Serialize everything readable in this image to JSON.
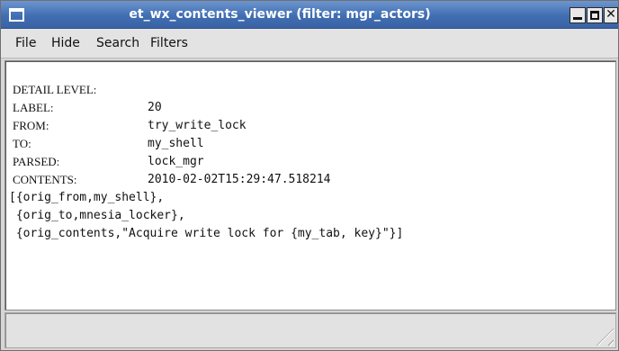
{
  "window": {
    "title": "et_wx_contents_viewer (filter: mgr_actors)"
  },
  "menu": {
    "items": [
      "File",
      "Hide",
      "Search",
      "Filters"
    ]
  },
  "detail": {
    "fields": [
      {
        "key": "DETAIL LEVEL:",
        "value": "20"
      },
      {
        "key": "LABEL:",
        "value": "try_write_lock"
      },
      {
        "key": "FROM:",
        "value": "my_shell"
      },
      {
        "key": "TO:",
        "value": "lock_mgr"
      },
      {
        "key": "PARSED:",
        "value": "2010-02-02T15:29:47.518214"
      },
      {
        "key": "CONTENTS:",
        "value": ""
      }
    ],
    "contents_lines": [
      "[{orig_from,my_shell},",
      " {orig_to,mnesia_locker},",
      " {orig_contents,\"Acquire write lock for {my_tab, key}\"}]"
    ]
  },
  "statusbar": {
    "text": ""
  }
}
